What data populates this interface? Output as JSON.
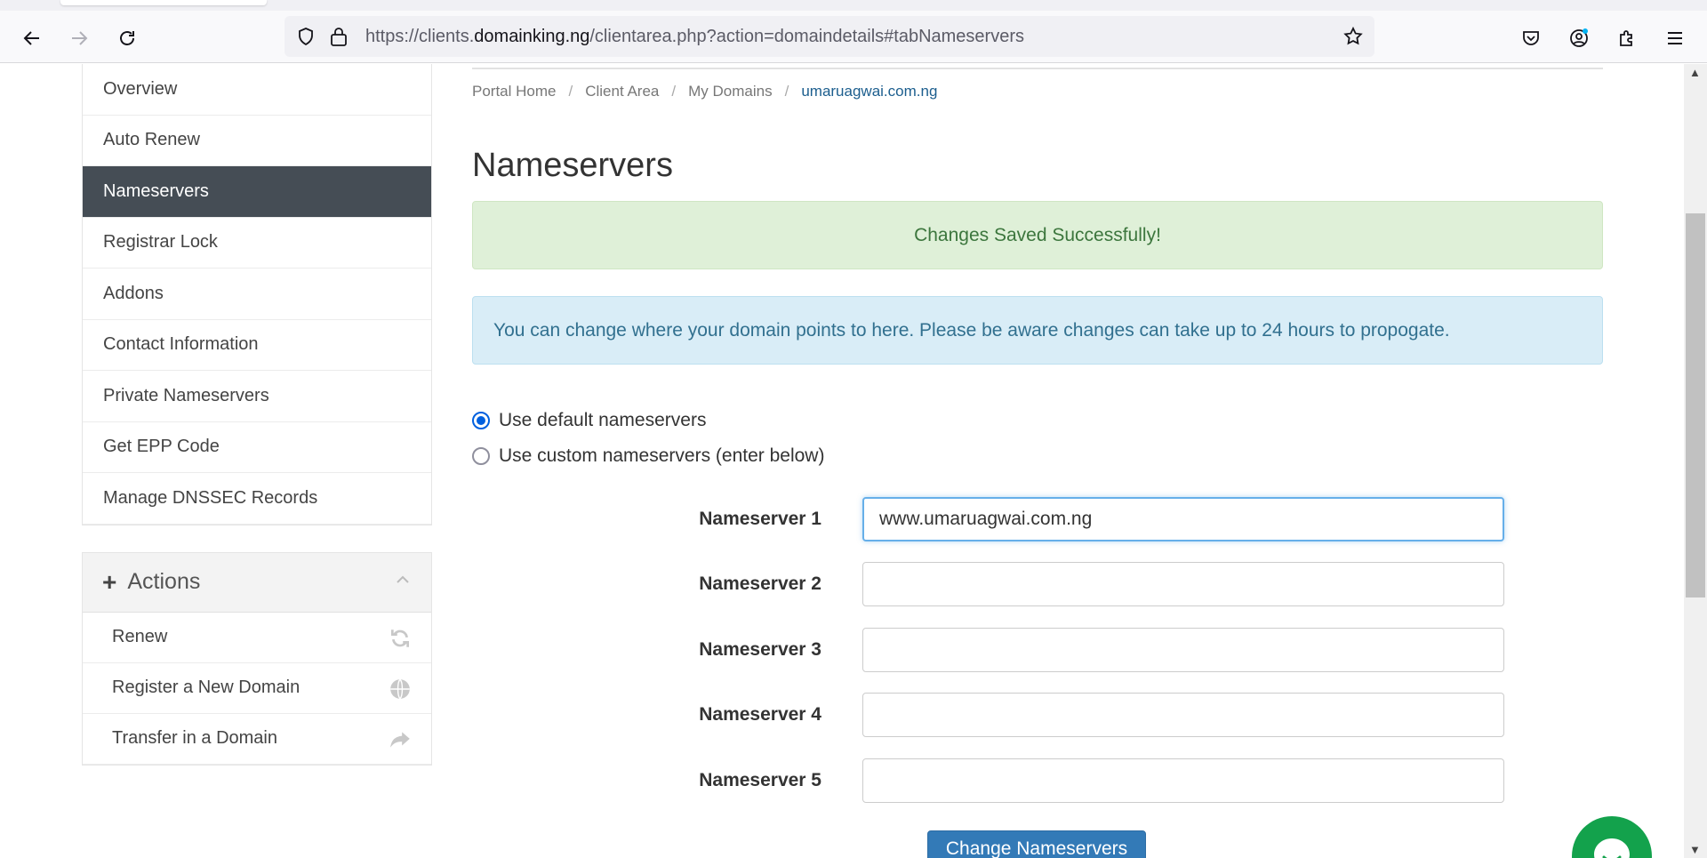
{
  "browser": {
    "url_prefix": "https://clients.",
    "url_domain": "domainking.ng",
    "url_suffix": "/clientarea.php?action=domaindetails#tabNameservers"
  },
  "sidebar": {
    "items": [
      {
        "label": "Overview"
      },
      {
        "label": "Auto Renew"
      },
      {
        "label": "Nameservers",
        "active": true
      },
      {
        "label": "Registrar Lock"
      },
      {
        "label": "Addons"
      },
      {
        "label": "Contact Information"
      },
      {
        "label": "Private Nameservers"
      },
      {
        "label": "Get EPP Code"
      },
      {
        "label": "Manage DNSSEC Records"
      }
    ],
    "actions": {
      "title": "Actions",
      "items": [
        {
          "label": "Renew",
          "icon": "refresh-icon"
        },
        {
          "label": "Register a New Domain",
          "icon": "globe-icon"
        },
        {
          "label": "Transfer in a Domain",
          "icon": "share-arrow-icon"
        }
      ]
    }
  },
  "breadcrumb": [
    "Portal Home",
    "Client Area",
    "My Domains",
    "umaruagwai.com.ng"
  ],
  "page_title": "Nameservers",
  "alert_success": "Changes Saved Successfully!",
  "alert_info": "You can change where your domain points to here. Please be aware changes can take up to 24 hours to propogate.",
  "radio_default": "Use default nameservers",
  "radio_custom": "Use custom nameservers (enter below)",
  "nameservers": [
    {
      "label": "Nameserver 1",
      "value": "www.umaruagwai.com.ng"
    },
    {
      "label": "Nameserver 2",
      "value": ""
    },
    {
      "label": "Nameserver 3",
      "value": ""
    },
    {
      "label": "Nameserver 4",
      "value": ""
    },
    {
      "label": "Nameserver 5",
      "value": ""
    }
  ],
  "submit_label": "Change Nameservers",
  "colors": {
    "active_menu": "#454d55",
    "success_bg": "#dff0d8",
    "info_bg": "#d9edf7",
    "primary": "#337ab7",
    "chat": "#13a24c"
  }
}
